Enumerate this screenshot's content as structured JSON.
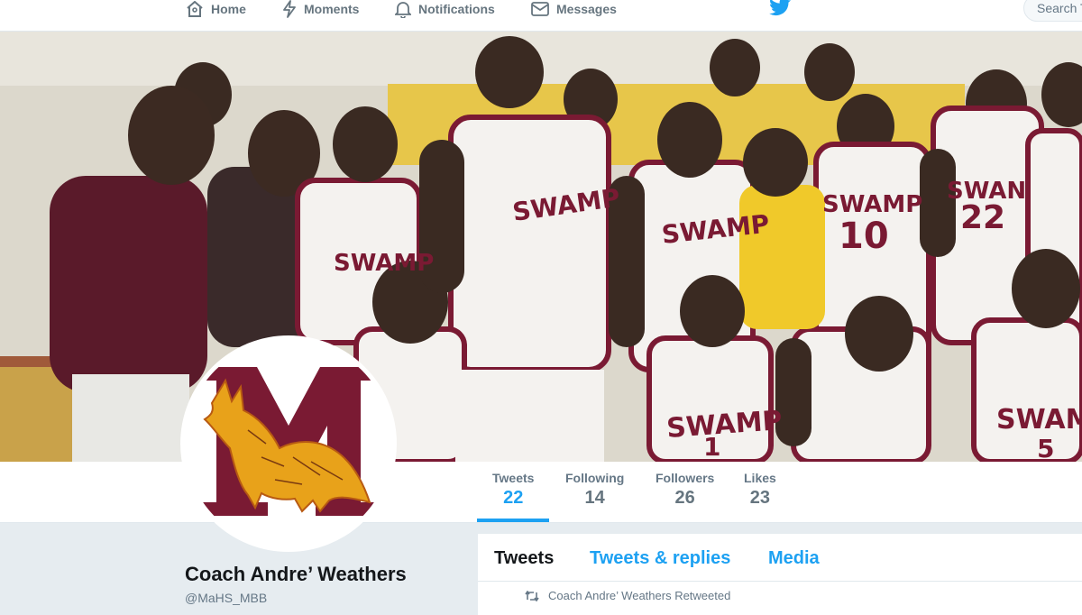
{
  "nav": {
    "home": "Home",
    "moments": "Moments",
    "notifications": "Notifications",
    "messages": "Messages",
    "search_placeholder": "Search T"
  },
  "banner": {
    "jersey_texts": [
      "SWAMP",
      "SWAMP",
      "SWAMP",
      "SWAMP",
      "SWAMP",
      "SWAMP",
      "SWAN"
    ],
    "jersey_numbers": [
      "10",
      "22",
      "1",
      "5"
    ]
  },
  "stats": [
    {
      "label": "Tweets",
      "value": "22"
    },
    {
      "label": "Following",
      "value": "14"
    },
    {
      "label": "Followers",
      "value": "26"
    },
    {
      "label": "Likes",
      "value": "23"
    }
  ],
  "profile": {
    "name": "Coach Andre’ Weathers",
    "handle": "@MaHS_MBB"
  },
  "tabs": {
    "tweets": "Tweets",
    "tweets_replies": "Tweets & replies",
    "media": "Media"
  },
  "retweet_note": "Coach Andre’ Weathers Retweeted",
  "colors": {
    "accent": "#1da1f2",
    "maroon": "#7a1a33",
    "gold": "#e8a21a"
  }
}
